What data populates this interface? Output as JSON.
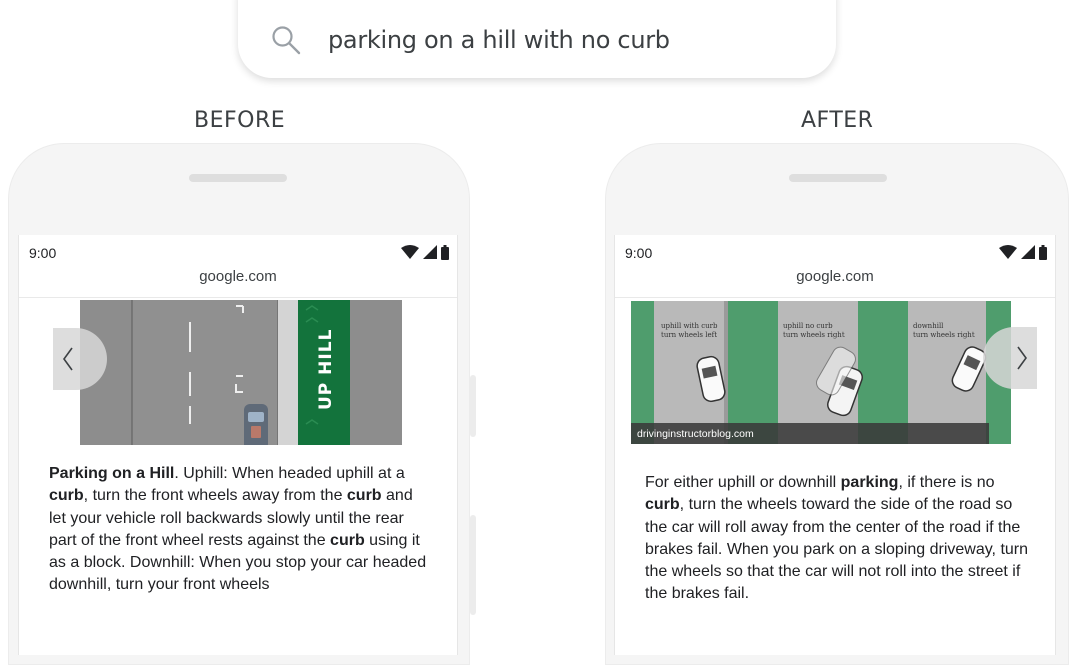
{
  "search": {
    "query": "parking on a hill with no curb"
  },
  "labels": {
    "before": "BEFORE",
    "after": "AFTER"
  },
  "before_phone": {
    "time": "9:00",
    "url": "google.com",
    "image": {
      "sign_text": "UP HILL"
    },
    "snippet": {
      "lead_bold": "Parking on a Hill",
      "p1": ". Uphill: When headed uphill at a ",
      "b1": "curb",
      "p2": ", turn the front wheels away from the ",
      "b2": "curb",
      "p3": " and let your vehicle roll backwards slowly until the rear part of the front wheel rests against the ",
      "b3": "curb",
      "p4": " using it as a block. Downhill: When you stop your car headed downhill, turn your front wheels"
    }
  },
  "after_phone": {
    "time": "9:00",
    "url": "google.com",
    "image": {
      "source": "drivinginstructorblog.com",
      "panels": [
        {
          "line1": "uphill with curb",
          "line2": "turn wheels left"
        },
        {
          "line1": "uphill no curb",
          "line2": "turn wheels right"
        },
        {
          "line1": "downhill",
          "line2": "turn wheels right"
        }
      ]
    },
    "snippet": {
      "p1": "For either uphill or downhill ",
      "b1": "parking",
      "p2": ", if there is no ",
      "b2": "curb",
      "p3": ", turn the wheels toward the side of the road so the car will roll away from the center of the road if the brakes fail. When you park on a sloping driveway, turn the wheels so that the car will not roll into the street if the brakes fail."
    }
  }
}
